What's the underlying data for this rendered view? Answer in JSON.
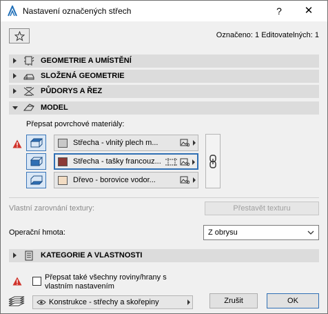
{
  "window": {
    "title": "Nastavení označených střech",
    "help_label": "?",
    "close_label": "✕",
    "icon": "archicad-logo-icon"
  },
  "header": {
    "favorites_icon": "star-icon",
    "selection_info": "Označeno: 1 Editovatelných: 1"
  },
  "sections": {
    "geometry": {
      "label": "GEOMETRIE A UMÍSTĚNÍ",
      "icon": "geometry-placement-icon",
      "expanded": false
    },
    "complex": {
      "label": "SLOŽENÁ GEOMETRIE",
      "icon": "complex-geometry-icon",
      "expanded": false
    },
    "floorplan": {
      "label": "PŮDORYS A ŘEZ",
      "icon": "floorplan-section-icon",
      "expanded": false
    },
    "model": {
      "label": "MODEL",
      "icon": "model-icon",
      "expanded": true
    },
    "categories": {
      "label": "KATEGORIE A VLASTNOSTI",
      "icon": "categories-properties-icon",
      "expanded": false
    }
  },
  "model": {
    "override_label": "Přepsat povrchové materiály:",
    "materials": [
      {
        "name": "Střecha - vlnitý plech m...",
        "color": "#c8c8c8"
      },
      {
        "name": "Střecha - tašky francouz...",
        "color": "#8b3a37"
      },
      {
        "name": "Dřevo - borovice vodor...",
        "color": "#f2dcc3"
      }
    ],
    "texture_label": "Vlastní zarovnání textury:",
    "texture_button": "Přestavět texturu",
    "operation_label": "Operační hmota:",
    "operation_value": "Z obrysu"
  },
  "footer": {
    "override_all_line1": "Přepsat také všechny roviny/hrany s",
    "override_all_line2": "vlastním nastavením",
    "override_all_checked": false,
    "layer_value": "Konstrukce - střechy a skořepiny",
    "cancel_label": "Zrušit",
    "ok_label": "OK"
  },
  "colors": {
    "accent": "#2f6fb4",
    "warning": "#d0332b",
    "section_bar": "#dcdcdc",
    "dialog_bg": "#f0f0f0"
  }
}
